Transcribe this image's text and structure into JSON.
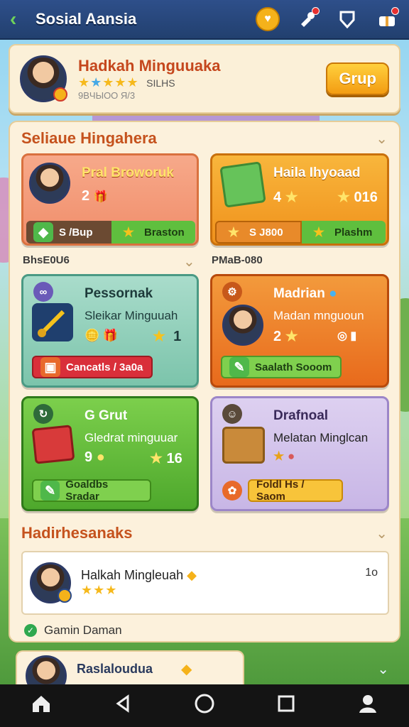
{
  "header": {
    "title": "Sosial Aansia",
    "back_icon": "‹",
    "coin_icon": "♥",
    "icons": [
      "coin-icon",
      "whistle-icon",
      "shield-icon",
      "gift-icon"
    ]
  },
  "profile": {
    "name": "Hadkah Minguuaka",
    "level_text": "SILHS",
    "meta": "9BЧЫОО Я/3",
    "button": "Grup"
  },
  "section1": {
    "title": "Seliaue Hingahera"
  },
  "cards": {
    "c1": {
      "title": "Pral Broworuk",
      "count": "2",
      "pill_left": "S /Bup",
      "pill_right": "Braston"
    },
    "c2": {
      "title": "Haila Ihyoaad",
      "count": "4",
      "count2": "016",
      "pill_left": "S J800",
      "pill_right": "Plashm"
    },
    "label_left": "BhsE0U6",
    "label_right": "PMaB-080",
    "c3": {
      "title": "Pessornak",
      "sub": "Sleikar Minguuah",
      "count": "1",
      "pill": "Cancatls / 3a0a"
    },
    "c4": {
      "title": "Madrian",
      "sub": "Madan mnguoun",
      "count": "2",
      "pill": "Saalath Sooom"
    },
    "c5": {
      "title": "G Grut",
      "sub": "Gledrat minguuar",
      "count": "9",
      "count2": "16",
      "pill": "Goaldbs Sradar"
    },
    "c6": {
      "title": "Drafnoal",
      "sub": "Melatan Minglcan",
      "pill": "Foldl Hs / Saom"
    }
  },
  "section2": {
    "title": "Hadirhesanaks"
  },
  "recent": {
    "name": "Halkah Mingleuah",
    "time": "1o"
  },
  "status": {
    "text": "Gamin Daman"
  },
  "peek": {
    "name": "Raslaloudua"
  },
  "colors": {
    "accent": "#c5471d",
    "topbar": "#2e4f8a",
    "coin": "#f5b21a"
  }
}
